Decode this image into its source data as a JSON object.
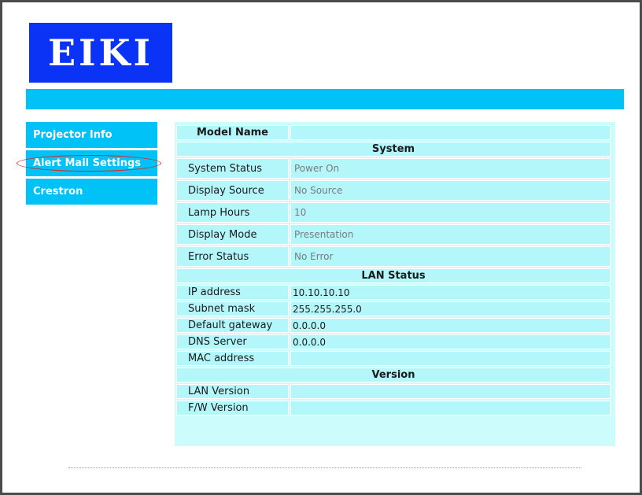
{
  "brand": {
    "logo_text": "EIKI",
    "banner_color": "#00c2f7",
    "logo_color": "#0a33f5"
  },
  "nav": {
    "items": [
      {
        "label": "Projector Info"
      },
      {
        "label": "Alert Mail Settings",
        "highlighted": true
      },
      {
        "label": "Crestron"
      }
    ]
  },
  "info": {
    "model_name_label": "Model Name",
    "model_name_value": "",
    "system_header": "System",
    "system_rows": [
      {
        "label": "System Status",
        "value": "Power On"
      },
      {
        "label": "Display Source",
        "value": "No Source"
      },
      {
        "label": "Lamp Hours",
        "value": "10"
      },
      {
        "label": "Display Mode",
        "value": "Presentation"
      },
      {
        "label": "Error Status",
        "value": "No Error"
      }
    ],
    "lan_header": "LAN Status",
    "lan_rows": [
      {
        "label": "IP address",
        "value": "10.10.10.10"
      },
      {
        "label": "Subnet mask",
        "value": "255.255.255.0"
      },
      {
        "label": "Default gateway",
        "value": "0.0.0.0"
      },
      {
        "label": "DNS Server",
        "value": "0.0.0.0"
      },
      {
        "label": "MAC address",
        "value": ""
      }
    ],
    "version_header": "Version",
    "version_rows": [
      {
        "label": "LAN Version",
        "value": ""
      },
      {
        "label": "F/W Version",
        "value": ""
      }
    ]
  }
}
